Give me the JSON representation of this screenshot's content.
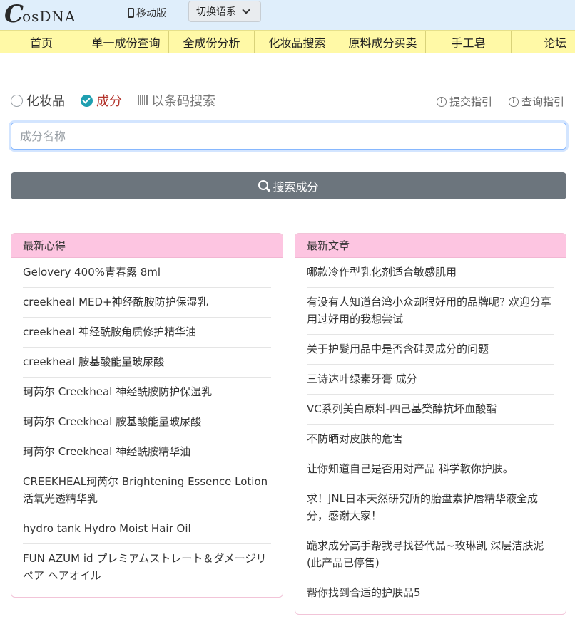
{
  "header": {
    "logo_c": "C",
    "logo_rest": "osDNA",
    "mobile_label": "移动版",
    "language_button": "切换语系"
  },
  "nav": {
    "items": [
      "首页",
      "单一成份查询",
      "全成份分析",
      "化妆品搜索",
      "原料成分买卖",
      "手工皂",
      "论坛"
    ]
  },
  "search": {
    "options": {
      "cosmetic": "化妆品",
      "ingredient": "成分",
      "barcode": "以条码搜索"
    },
    "selected": "成分",
    "submit_guide": "提交指引",
    "query_guide": "查询指引",
    "placeholder": "成分名称",
    "value": "",
    "button_label": "搜索成分"
  },
  "latest_reviews": {
    "title": "最新心得",
    "items": [
      "Gelovery 400%青春露 8ml",
      "creekheal MED+神经酰胺防护保湿乳",
      "creekheal 神经酰胺角质修护精华油",
      "creekheal 胺基酸能量玻尿酸",
      "珂芮尔 Creekheal 神经酰胺防护保湿乳",
      "珂芮尔 Creekheal 胺基酸能量玻尿酸",
      "珂芮尔 Creekheal 神经酰胺精华油",
      "CREEKHEAL珂芮尔 Brightening Essence Lotion 活氧光透精华乳",
      "hydro tank Hydro Moist Hair Oil",
      "FUN AZUM id プレミアムストレート＆ダメージリペア ヘアオイル"
    ]
  },
  "latest_articles": {
    "title": "最新文章",
    "items": [
      "哪款冷作型乳化剂适合敏感肌用",
      "有没有人知道台湾小众却很好用的品牌呢? 欢迎分享用过好用的我想尝试",
      "关于护髮用品中是否含硅灵成分的问题",
      "三诗达叶绿素牙膏 成分",
      "VC系列美白原料-四己基癸醇抗坏血酸酯",
      "不防晒对皮肤的危害",
      "让你知道自己是否用对产品 科学教你护肤。",
      "求！JNL日本天然研究所的胎盘素护唇精华液全成分，感谢大家！",
      "跪求成分高手帮我寻找替代品~玫琳凯 深层洁肤泥(此产品已停售)",
      "帮你找到合适的护肤品5"
    ]
  }
}
